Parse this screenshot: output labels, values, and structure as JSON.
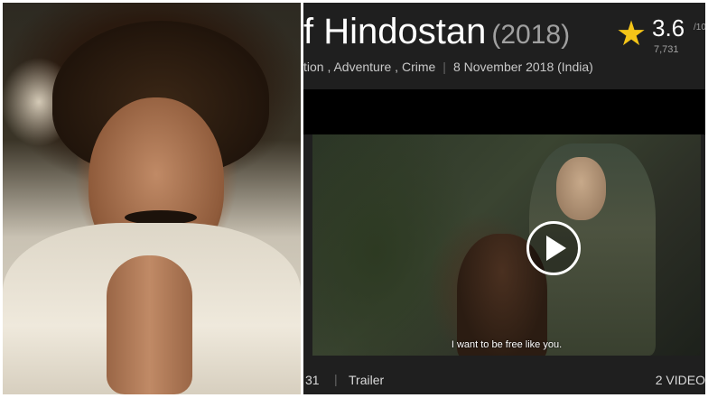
{
  "movie": {
    "title": "f Hindostan",
    "year": "(2018)",
    "rating": "3.6",
    "rating_max": "/10",
    "rating_count": "7,731",
    "genres_text": "tion , Adventure , Crime",
    "release_date": "8 November 2018 (India)"
  },
  "video": {
    "subtitle": "I want to be free like you.",
    "play_icon": "play-icon"
  },
  "footer": {
    "duration": "31",
    "trailer_label": "Trailer",
    "videos_total": "2 VIDEO"
  },
  "colors": {
    "accent_star": "#f5c518",
    "panel_bg": "#1f1f1f"
  }
}
